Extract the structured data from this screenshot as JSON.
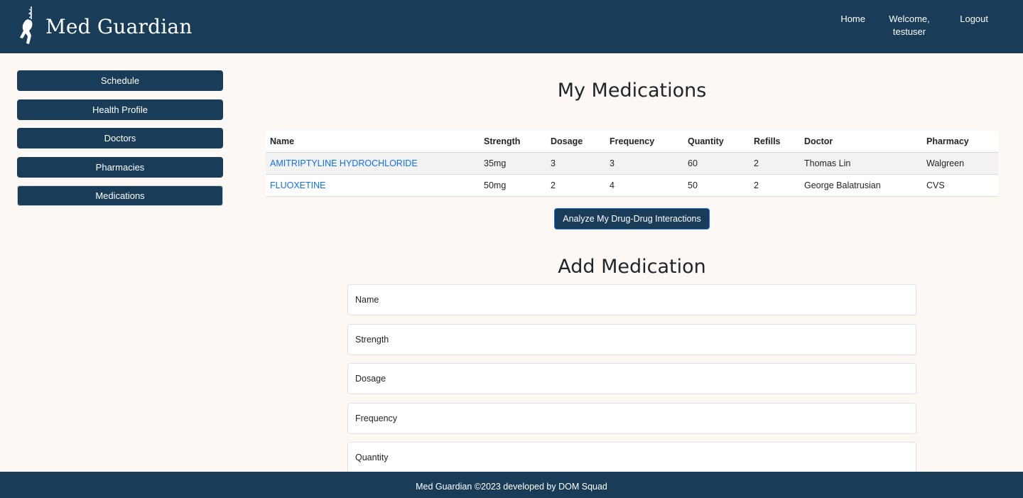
{
  "brand": {
    "name": "Med Guardian",
    "logo_icon": "caduceus-runner-icon"
  },
  "nav": {
    "home": "Home",
    "welcome": "Welcome,",
    "username": "testuser",
    "logout": "Logout"
  },
  "sidebar": {
    "items": [
      {
        "label": "Schedule"
      },
      {
        "label": "Health Profile"
      },
      {
        "label": "Doctors"
      },
      {
        "label": "Pharmacies"
      },
      {
        "label": "Medications"
      }
    ]
  },
  "main": {
    "title": "My Medications",
    "table": {
      "headers": [
        "Name",
        "Strength",
        "Dosage",
        "Frequency",
        "Quantity",
        "Refills",
        "Doctor",
        "Pharmacy"
      ],
      "rows": [
        {
          "name": "AMITRIPTYLINE HYDROCHLORIDE",
          "strength": "35mg",
          "dosage": "3",
          "frequency": "3",
          "quantity": "60",
          "refills": "2",
          "doctor": "Thomas Lin",
          "pharmacy": "Walgreen"
        },
        {
          "name": "FLUOXETINE",
          "strength": "50mg",
          "dosage": "2",
          "frequency": "4",
          "quantity": "50",
          "refills": "2",
          "doctor": "George Balatrusian",
          "pharmacy": "CVS"
        }
      ]
    },
    "analyze_button": "Analyze My Drug-Drug Interactions",
    "add_title": "Add Medication",
    "form": {
      "name_placeholder": "Name",
      "strength_placeholder": "Strength",
      "dosage_placeholder": "Dosage",
      "frequency_placeholder": "Frequency",
      "quantity_placeholder": "Quantity"
    }
  },
  "footer": {
    "text": "Med Guardian ©2023 developed by DOM Squad"
  },
  "colors": {
    "primary": "#193d58",
    "background": "#fdf8f3",
    "link": "#0d6efd"
  }
}
